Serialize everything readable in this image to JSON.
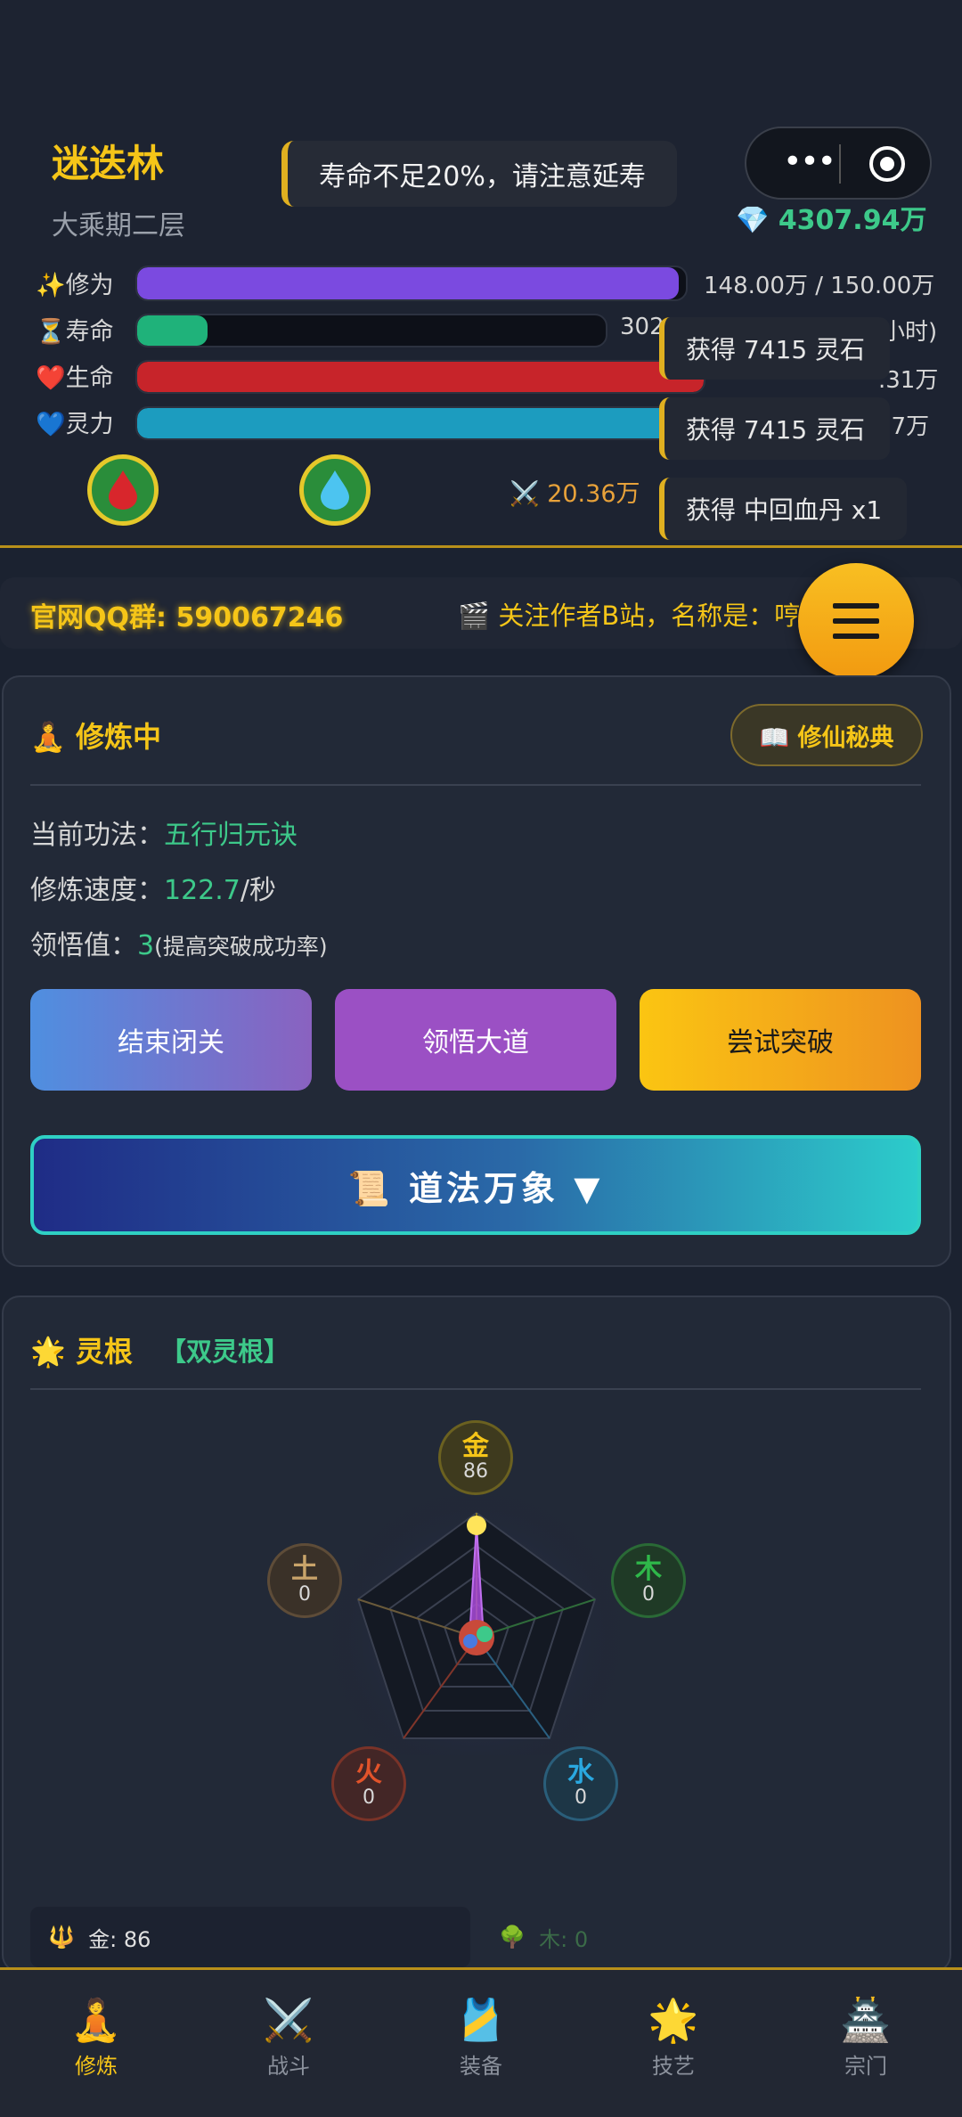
{
  "header": {
    "location": "迷迭林",
    "realm": "大乘期二层",
    "notice": "寿命不足20%，请注意延寿",
    "spirit_stones": "4307.94万",
    "menu_dots": "•••",
    "attack": "20.36万"
  },
  "stats": [
    {
      "icon": "✨",
      "label": "修为",
      "value": "148.00万 / 150.00万",
      "fill": 0.987,
      "color": "#7b4ae0"
    },
    {
      "icon": "⏳",
      "label": "寿命",
      "value": "302",
      "value_suffix": "小时)",
      "fill": 0.15,
      "color": "#1fb27a"
    },
    {
      "icon": "❤️",
      "label": "生命",
      "value": ".31万",
      "fill": 1.0,
      "color": "#c7242a"
    },
    {
      "icon": "💙",
      "label": "灵力",
      "value": "37万",
      "fill": 0.9,
      "color": "#1c9cbf"
    }
  ],
  "toasts": [
    "获得 7415 灵石",
    "获得 7415 灵石",
    "获得 中回血丹 x1"
  ],
  "marquee": {
    "qq": "官网QQ群: 590067246",
    "follow": "🎬 关注作者B站，名称是：哼哼王"
  },
  "cultivation": {
    "title": "修炼中",
    "title_icon": "🧘",
    "secret_button": "📖 修仙秘典",
    "method_label": "当前功法：",
    "method_value": "五行归元诀",
    "speed_label": "修炼速度：",
    "speed_value": "122.7",
    "speed_unit": "/秒",
    "insight_label": "领悟值：",
    "insight_value": "3",
    "insight_note": "(提高突破成功率)",
    "buttons": [
      "结束闭关",
      "领悟大道",
      "尝试突破"
    ],
    "dao_button": "📜 道法万象 ▼"
  },
  "spirit_root": {
    "title": "灵根",
    "title_icon": "🌟",
    "type": "【双灵根】",
    "elements": [
      {
        "name": "金",
        "value": "86",
        "color": "#f5c518"
      },
      {
        "name": "木",
        "value": "0",
        "color": "#2fb84a"
      },
      {
        "name": "水",
        "value": "0",
        "color": "#2aa8e0"
      },
      {
        "name": "火",
        "value": "0",
        "color": "#e2532a"
      },
      {
        "name": "土",
        "value": "0",
        "color": "#c9a46a"
      }
    ],
    "chip_gold": "金: 86",
    "chip_gold_icon": "🔱",
    "chip_wood": "木: 0",
    "chip_wood_icon": "🌳"
  },
  "tabs": [
    {
      "icon": "🧘",
      "label": "修炼"
    },
    {
      "icon": "⚔️",
      "label": "战斗"
    },
    {
      "icon": "🎽",
      "label": "装备"
    },
    {
      "icon": "🌟",
      "label": "技艺"
    },
    {
      "icon": "🏯",
      "label": "宗门"
    }
  ]
}
